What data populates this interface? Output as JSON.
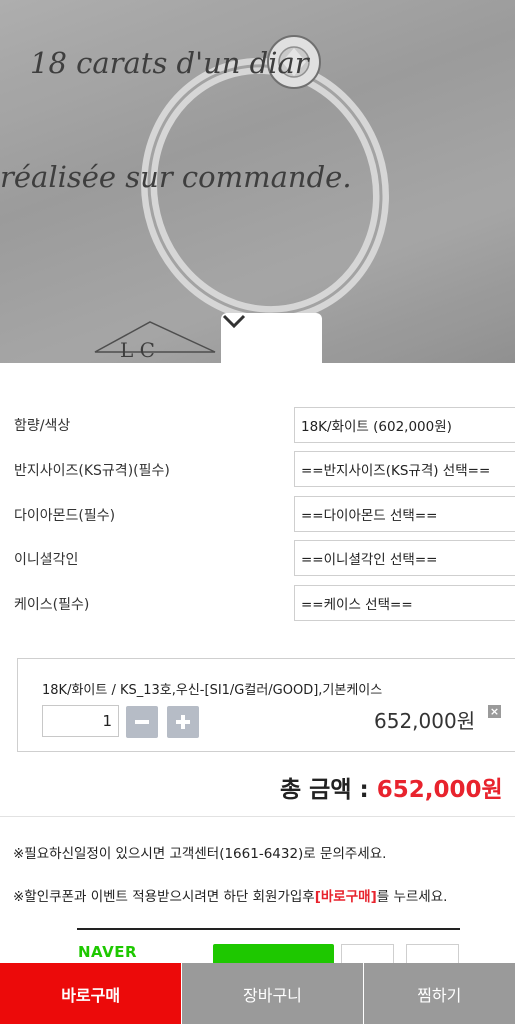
{
  "hero": {
    "text_line1": "18 carats   d'un diar",
    "text_line2": "réalisée sur commande.",
    "text_line3": "L C"
  },
  "options": [
    {
      "label": "함량/색상",
      "value": "18K/화이트 (602,000원)"
    },
    {
      "label": "반지사이즈(KS규격)(필수)",
      "value": "==반지사이즈(KS규격) 선택=="
    },
    {
      "label": "다이아몬드(필수)",
      "value": "==다이아몬드 선택=="
    },
    {
      "label": "이니셜각인",
      "value": "==이니셜각인 선택=="
    },
    {
      "label": "케이스(필수)",
      "value": "==케이스 선택=="
    }
  ],
  "selected_item": {
    "name": "18K/화이트 / KS_13호,우신-[SI1/G컬러/GOOD],기본케이스",
    "quantity": "1",
    "price": "652,000원",
    "remove_glyph": "×"
  },
  "total": {
    "label": "총 금액 : ",
    "amount": "652,000원"
  },
  "notices": {
    "line1": "※필요하신일정이 있으시면 고객센터(1661-6432)로 문의주세요.",
    "line2_pre": "※할인쿠폰과 이벤트 적용받으시려면 하단 회원가입후",
    "line2_red": "[바로구매]",
    "line2_post": "를 누르세요."
  },
  "naver": {
    "logo": "NAVER"
  },
  "bottom_bar": {
    "buy": "바로구매",
    "cart": "장바구니",
    "wish": "찜하기"
  },
  "colors": {
    "accent_red": "#e8232d",
    "buy_button": "#ec0a0a",
    "naver_green": "#1ec800",
    "bar_gray": "#9a9a9a"
  }
}
